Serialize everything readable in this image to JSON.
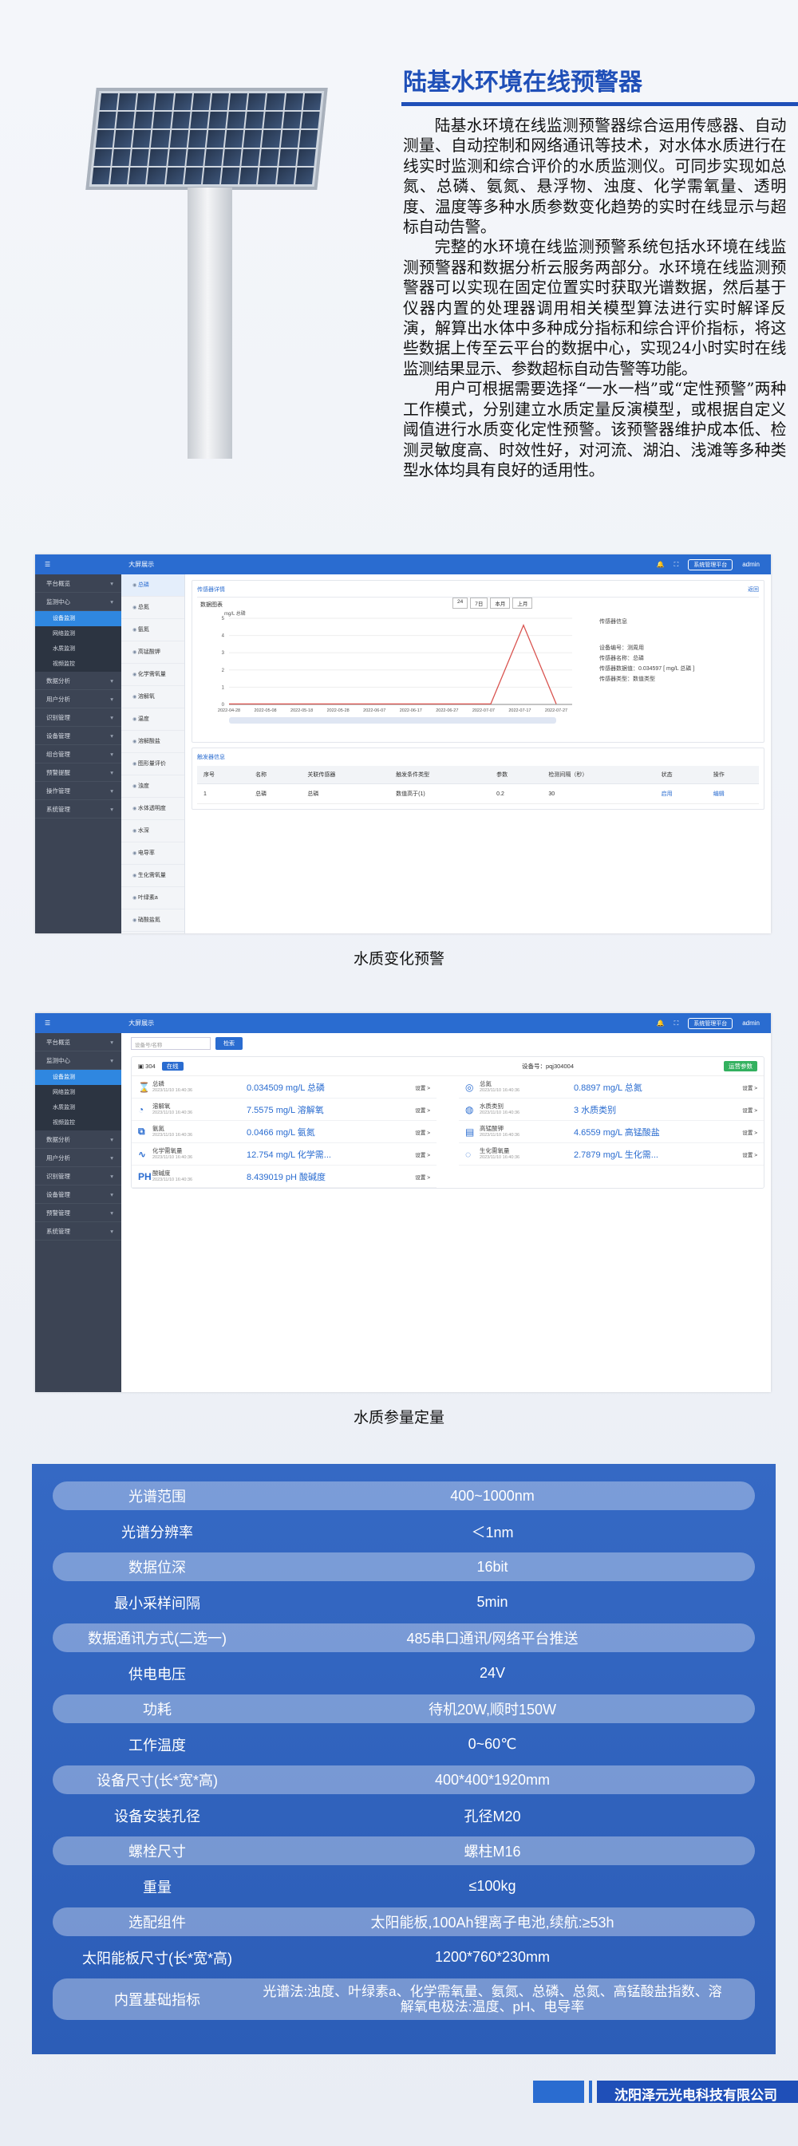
{
  "header": {
    "title": "陆基水环境在线预警器"
  },
  "description": [
    "陆基水环境在线监测预警器综合运用传感器、自动测量、自动控制和网络通讯等技术，对水体水质进行在线实时监测和综合评价的水质监测仪。可同步实现如总氮、总磷、氨氮、悬浮物、浊度、化学需氧量、透明度、温度等多种水质参数变化趋势的实时在线显示与超标自动告警。",
    "完整的水环境在线监测预警系统包括水环境在线监测预警器和数据分析云服务两部分。水环境在线监测预警器可以实现在固定位置实时获取光谱数据，然后基于仪器内置的处理器调用相关模型算法进行实时解译反演，解算出水体中多种成分指标和综合评价指标，将这些数据上传至云平台的数据中心，实现24小时实时在线监测结果显示、参数超标自动告警等功能。",
    "用户可根据需要选择“一水一档”或“定性预警”两种工作模式，分别建立水质定量反演模型，或根据自定义阈值进行水质变化定性预警。该预警器维护成本低、检测灵敏度高、时效性好，对河流、湖泊、浅滩等多种类型水体均具有良好的适用性。"
  ],
  "app": {
    "system_name": "大屏展示",
    "user": "admin",
    "screen_btn": "系统管理平台"
  },
  "sidebar": {
    "items": [
      "平台概览",
      "监测中心",
      "数据分析",
      "用户分析",
      "识别管理",
      "设备管理",
      "组合管理",
      "预警提醒",
      "操作管理",
      "系统管理"
    ],
    "subs": [
      "设备监测",
      "网络监测",
      "水质监测",
      "视频监控"
    ]
  },
  "sidebar2": {
    "items": [
      "平台概览",
      "监测中心",
      "数据分析",
      "用户分析",
      "识别管理",
      "设备管理",
      "预警管理",
      "系统管理"
    ],
    "subs": [
      "设备监测",
      "网络监测",
      "水质监测",
      "视频监控"
    ]
  },
  "submenu": [
    "总磷",
    "总氮",
    "氨氮",
    "高锰酸钾",
    "化学需氧量",
    "溶解氧",
    "温度",
    "溶解酸盐",
    "图形量评价",
    "浊度",
    "水体透明度",
    "水深",
    "电导率",
    "生化需氧量",
    "叶绿素a",
    "硝酸盐氮",
    "藻细度"
  ],
  "shot1": {
    "panel_title": "传感器详情",
    "panel_link": "返回",
    "chart_label": "数据图表",
    "filters": [
      "24",
      "7日",
      "本月",
      "上月"
    ],
    "info_title": "传感器信息",
    "info": [
      "设备编号：测周用",
      "传感器名称：总磷",
      "传感器数据值：0.034597 [ mg/L 总磷 ]",
      "传感器类型：数值类型"
    ],
    "table_title": "触发器信息",
    "table_headers": [
      "序号",
      "名称",
      "关联传感器",
      "触发条件类型",
      "参数",
      "检测间隔（秒）",
      "状态",
      "操作"
    ],
    "table_row": [
      "1",
      "总磷",
      "总磷",
      "数值高于(1)",
      "0.2",
      "30",
      "启用",
      "编辑"
    ]
  },
  "caption1": "水质变化预警",
  "shot2": {
    "search_placeholder": "设备号/名称",
    "search_btn": "检索",
    "device_id": "304",
    "status_tag": "在线",
    "device_no": "设备号：pqj304004",
    "alarm_tag": "运营参数",
    "link": "设置 >",
    "time": "2023/11/10 16:40:36",
    "params": [
      {
        "icon": "⌛",
        "name": "总磷",
        "value": "0.034509 mg/L 总磷"
      },
      {
        "icon": "◎",
        "name": "总氮",
        "value": "0.8897 mg/L 总氮"
      },
      {
        "icon": "◔",
        "name": "溶解氧",
        "value": "7.5575 mg/L 溶解氧"
      },
      {
        "icon": "◍",
        "name": "水质类别",
        "value": "3 水质类别"
      },
      {
        "icon": "⧉",
        "name": "氨氮",
        "value": "0.0466 mg/L 氨氮"
      },
      {
        "icon": "▤",
        "name": "高锰酸钾",
        "value": "4.6559 mg/L 高锰酸盐"
      },
      {
        "icon": "∿",
        "name": "化学需氧量",
        "value": "12.754 mg/L 化学需..."
      },
      {
        "icon": "◌",
        "name": "生化需氧量",
        "value": "2.7879 mg/L 生化需..."
      },
      {
        "icon": "PH",
        "name": "酸碱度",
        "value": "8.439019 pH 酸碱度"
      }
    ]
  },
  "caption2": "水质参量定量",
  "specs": [
    {
      "k": "光谱范围",
      "v": "400~1000nm"
    },
    {
      "k": "光谱分辨率",
      "v": "＜1nm"
    },
    {
      "k": "数据位深",
      "v": "16bit"
    },
    {
      "k": "最小采样间隔",
      "v": "5min"
    },
    {
      "k": "数据通讯方式(二选一)",
      "v": "485串口通讯/网络平台推送"
    },
    {
      "k": "供电电压",
      "v": "24V"
    },
    {
      "k": "功耗",
      "v": "待机20W,顺时150W"
    },
    {
      "k": "工作温度",
      "v": "0~60℃"
    },
    {
      "k": "设备尺寸(长*宽*高)",
      "v": "400*400*1920mm"
    },
    {
      "k": "设备安装孔径",
      "v": "孔径M20"
    },
    {
      "k": "螺栓尺寸",
      "v": "螺柱M16"
    },
    {
      "k": "重量",
      "v": "≤100kg"
    },
    {
      "k": "选配组件",
      "v": "太阳能板,100Ah锂离子电池,续航:≥53h"
    },
    {
      "k": "太阳能板尺寸(长*宽*高)",
      "v": "1200*760*230mm"
    },
    {
      "k": "内置基础指标",
      "v": "光谱法:浊度、叶绿素a、化学需氧量、氨氮、总磷、总氮、高锰酸盐指数、溶解氧电极法:温度、pH、电导率"
    }
  ],
  "footer": {
    "company": "沈阳泽元光电科技有限公司"
  },
  "chart_data": {
    "type": "line",
    "ylabel": "mg/L 总磷",
    "ylim": [
      0,
      5
    ],
    "yticks": [
      "0",
      "1",
      "2",
      "3",
      "4",
      "5"
    ],
    "x": [
      "2022-04-28",
      "2022-05-08",
      "2022-05-18",
      "2022-05-28",
      "2022-06-07",
      "2022-06-17",
      "2022-06-27",
      "2022-07-07",
      "2022-07-17",
      "2022-07-27"
    ],
    "series": [
      {
        "values": [
          0.03,
          0.03,
          0.03,
          0.03,
          0.03,
          0.03,
          0.03,
          0.03,
          0.03,
          4.6,
          0.03
        ]
      }
    ],
    "colors": {
      "line": "#d9534f"
    }
  }
}
